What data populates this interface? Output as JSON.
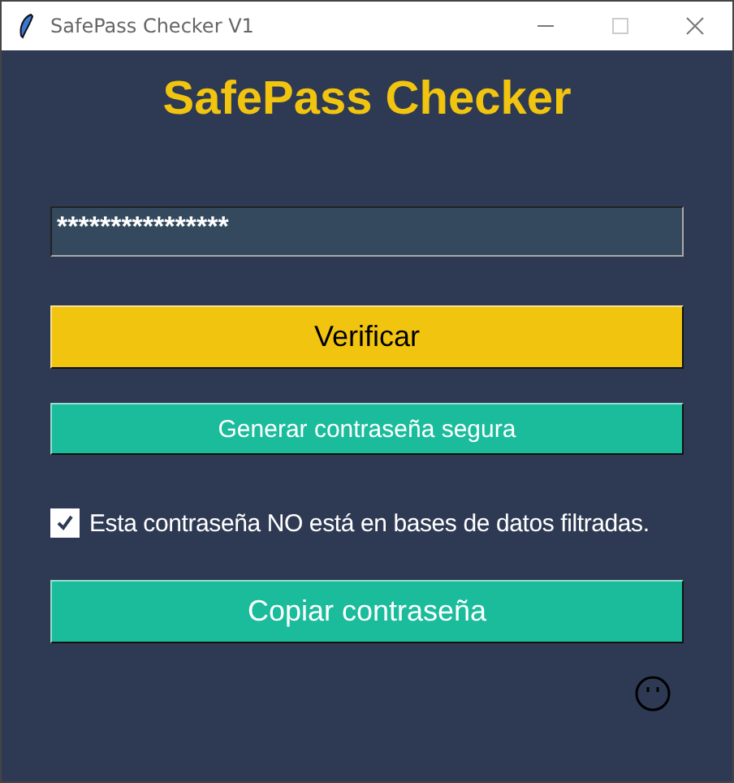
{
  "window": {
    "title": "SafePass Checker V1"
  },
  "heading": "SafePass Checker",
  "password_field": {
    "value": "****************"
  },
  "buttons": [
    {
      "label": "Verificar",
      "kind": "primary"
    },
    {
      "label": "Generar contraseña segura",
      "kind": "secondary"
    }
  ],
  "checkbox": {
    "label": "Esta contraseña NO está en bases de datos filtradas.",
    "checked": true
  },
  "copy_button": {
    "label": "Copiar contraseña"
  }
}
